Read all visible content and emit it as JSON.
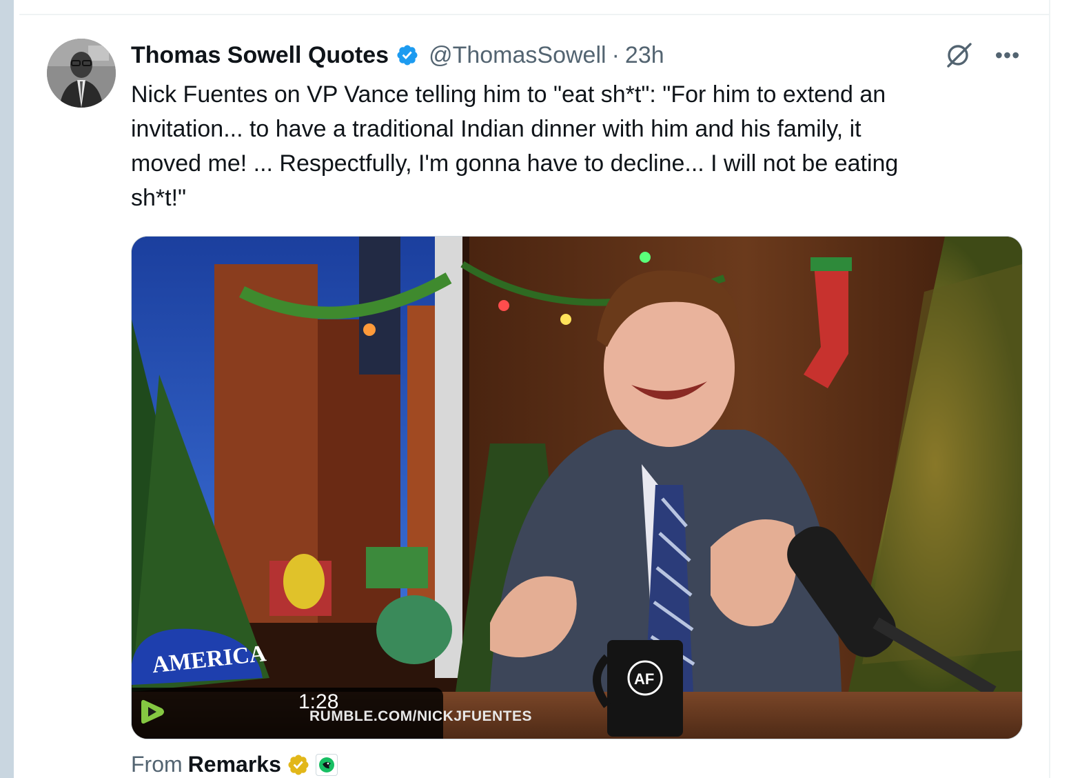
{
  "tweet": {
    "display_name": "Thomas Sowell Quotes",
    "handle": "@ThomasSowell",
    "separator": "·",
    "time": "23h",
    "more_label": "•••",
    "text": "Nick Fuentes on VP Vance telling him to \"eat sh*t\": \"For him to extend an\ninvitation... to have a traditional Indian dinner with him and his family, it\nmoved me! ... Respectfully, I'm gonna have to decline... I will not be eating\nsh*t!\"",
    "verified_icon": "verified-badge-icon",
    "brand_color": "#1d9bf0"
  },
  "video": {
    "duration": "1:28",
    "watermark": "RUMBLE.COM/NICKJFUENTES",
    "hat_text": "AMERICA",
    "mug_text": "AF"
  },
  "source": {
    "from_label": "From",
    "name": "Remarks",
    "gold_color": "#e2b719",
    "affiliate_color": "#17bf63"
  }
}
